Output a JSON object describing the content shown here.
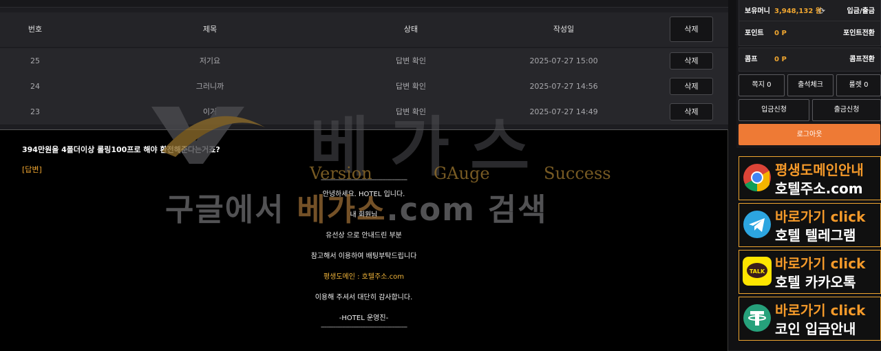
{
  "table": {
    "headers": {
      "no": "번호",
      "title": "제목",
      "status": "상태",
      "date": "작성일"
    },
    "header_delete_label": "삭제",
    "rows": [
      {
        "no": "25",
        "title": "저기요",
        "status": "답변 확인",
        "date": "2025-07-27 15:00",
        "delete_label": "삭제"
      },
      {
        "no": "24",
        "title": "그러니까",
        "status": "답변 확인",
        "date": "2025-07-27 14:56",
        "delete_label": "삭제"
      },
      {
        "no": "23",
        "title": "이거",
        "status": "답변 확인",
        "date": "2025-07-27 14:49",
        "delete_label": "삭제"
      }
    ]
  },
  "detail": {
    "question": "394만원을 4폴더이상 롤링100프로 해야 환전해준다는거죠?",
    "reply_tag": "[답변]",
    "divider": "------------------------------------------------",
    "lines": [
      "안녕하세요. HOTEL 입니다.",
      "내 회원님",
      "유선상 으로 안내드린 부분",
      "참고해서 이용하여 배팅부탁드립니다",
      "평생도메인 : 호텔주소.com",
      "이용해 주셔서 대단히 감사합니다.",
      "-HOTEL 운영진-"
    ]
  },
  "watermark": {
    "big": "베가스",
    "sub": [
      "Version",
      "GAuge",
      "Success"
    ],
    "line_pre": "구글에서 ",
    "line_hl": "베가스",
    "line_post": ".com 검색"
  },
  "sidebar": {
    "money_label": "보유머니",
    "money_value": "3,948,132 원",
    "deposit_withdraw": "입금/출금",
    "point_label": "포인트",
    "point_value": "0 P",
    "point_convert": "포인트전환",
    "comp_label": "콤프",
    "comp_value": "0 P",
    "comp_convert": "콤프전환",
    "btn_message": "쪽지 0",
    "btn_attendance": "출석체크",
    "btn_roulette": "룰렛 0",
    "btn_deposit": "입금신청",
    "btn_withdraw": "출금신청",
    "btn_logout": "로그아웃"
  },
  "banners": [
    {
      "top": "평생도메인안내",
      "bottom": "호텔주소.com",
      "icon": "chrome-icon"
    },
    {
      "top": "바로가기 click",
      "bottom": "호텔 텔레그램",
      "icon": "telegram-icon"
    },
    {
      "top": "바로가기 click",
      "bottom": "호텔 카카오톡",
      "icon": "kakaotalk-icon"
    },
    {
      "top": "바로가기 click",
      "bottom": "코인 입금안내",
      "icon": "tether-icon"
    }
  ],
  "colors": {
    "accent": "#f0a630",
    "logout": "#ee7a35",
    "gold_text": "#f0b43a"
  }
}
